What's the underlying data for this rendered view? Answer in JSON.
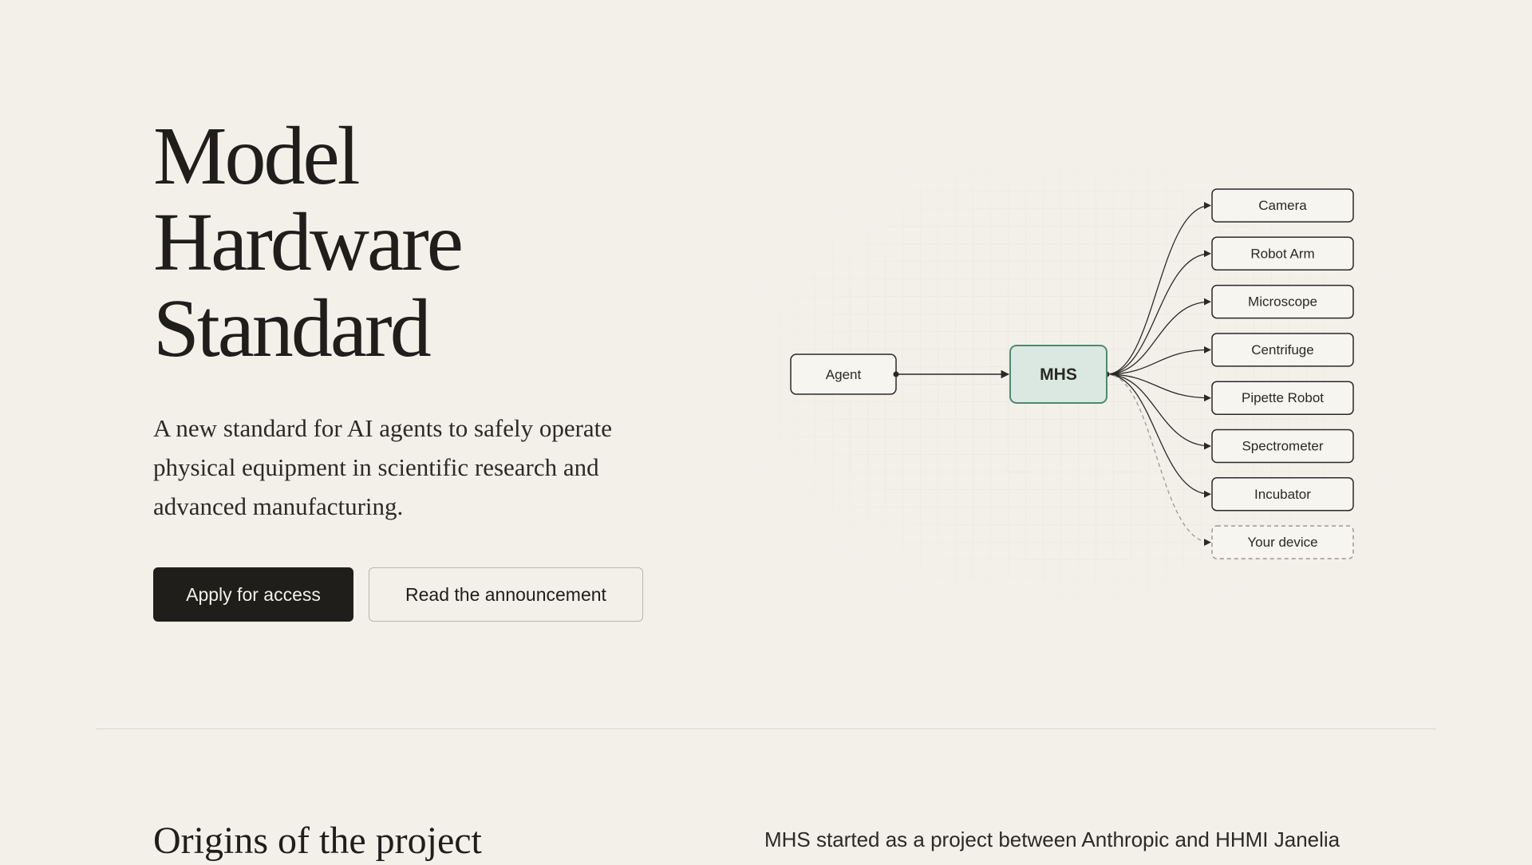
{
  "hero": {
    "title_lines": [
      "Model",
      "Hardware",
      "Standard"
    ],
    "description": "A new standard for AI agents to safely operate physical equipment in scientific research and advanced manufacturing.",
    "primary_button": "Apply for access",
    "secondary_button": "Read the announcement"
  },
  "diagram": {
    "agent_label": "Agent",
    "hub_label": "MHS",
    "devices": [
      "Camera",
      "Robot Arm",
      "Microscope",
      "Centrifuge",
      "Pipette Robot",
      "Spectrometer",
      "Incubator"
    ],
    "placeholder_device": "Your device",
    "colors": {
      "hub_fill": "#dbe8e1",
      "hub_stroke": "#4f8a6e",
      "line": "#2a2925",
      "dashed": "#9c988f"
    }
  },
  "origins": {
    "title": "Origins of the project",
    "text": "MHS started as a project between Anthropic and HHMI Janelia"
  }
}
